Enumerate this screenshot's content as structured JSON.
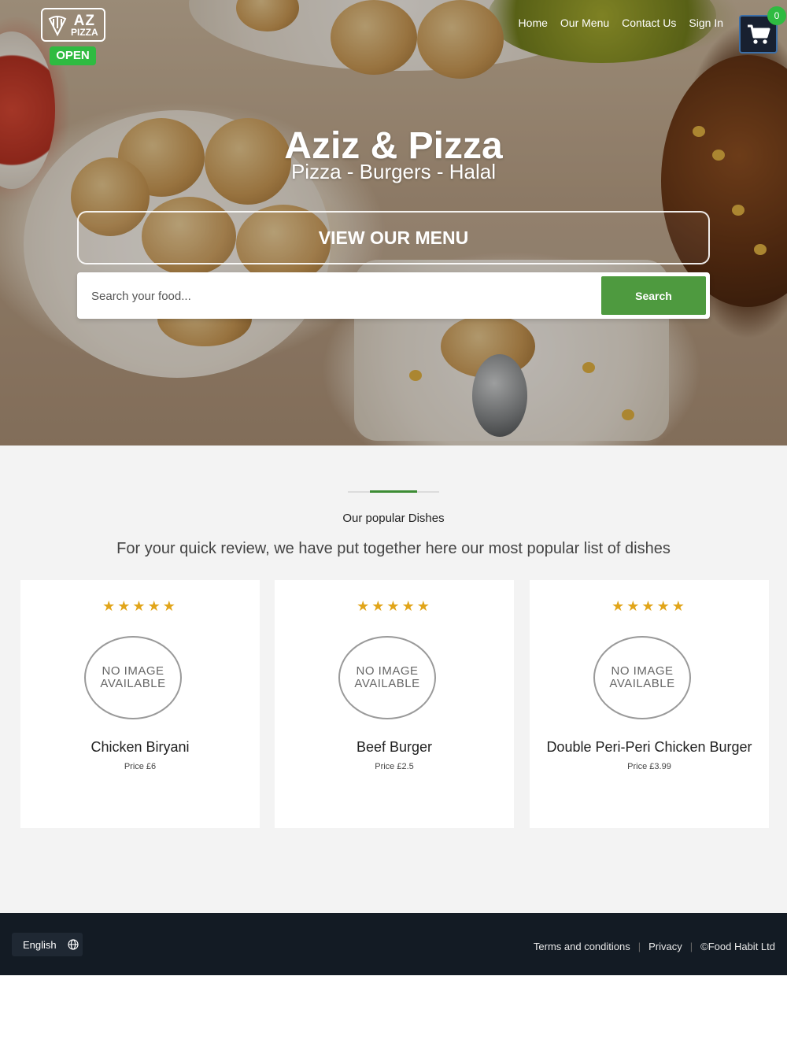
{
  "brand": {
    "logo_line1": "AZ",
    "logo_line2": "PIZZA",
    "status": "OPEN"
  },
  "nav": {
    "items": [
      "Home",
      "Our Menu",
      "Contact Us",
      "Sign In"
    ]
  },
  "cart": {
    "count": "0"
  },
  "hero": {
    "title": "Aziz & Pizza",
    "subtitle": "Pizza - Burgers - Halal",
    "menu_button": "VIEW OUR MENU"
  },
  "search": {
    "placeholder": "Search your food...",
    "button": "Search"
  },
  "popular": {
    "title": "Our popular Dishes",
    "description": "For your quick review, we have put together here our most popular list of dishes",
    "dishes": [
      {
        "stars": "★★★★★",
        "rating": 5,
        "image_text": "NO IMAGE AVAILABLE",
        "name": "Chicken Biryani",
        "price": "Price £6"
      },
      {
        "stars": "★★★★★",
        "rating": 5,
        "image_text": "NO IMAGE AVAILABLE",
        "name": "Beef Burger",
        "price": "Price £2.5"
      },
      {
        "stars": "★★★★★",
        "rating": 5,
        "image_text": "NO IMAGE AVAILABLE",
        "name": "Double Peri-Peri Chicken Burger",
        "price": "Price £3.99"
      }
    ]
  },
  "footer": {
    "language": "English",
    "terms": "Terms and conditions",
    "privacy": "Privacy",
    "copyright": "©Food Habit Ltd",
    "separator": "|"
  },
  "colors": {
    "accent_green": "#4e9a3f",
    "open_green": "#2fbb41",
    "star_gold": "#e1a51a",
    "footer_bg": "#131b24",
    "cart_bg": "#182030"
  }
}
